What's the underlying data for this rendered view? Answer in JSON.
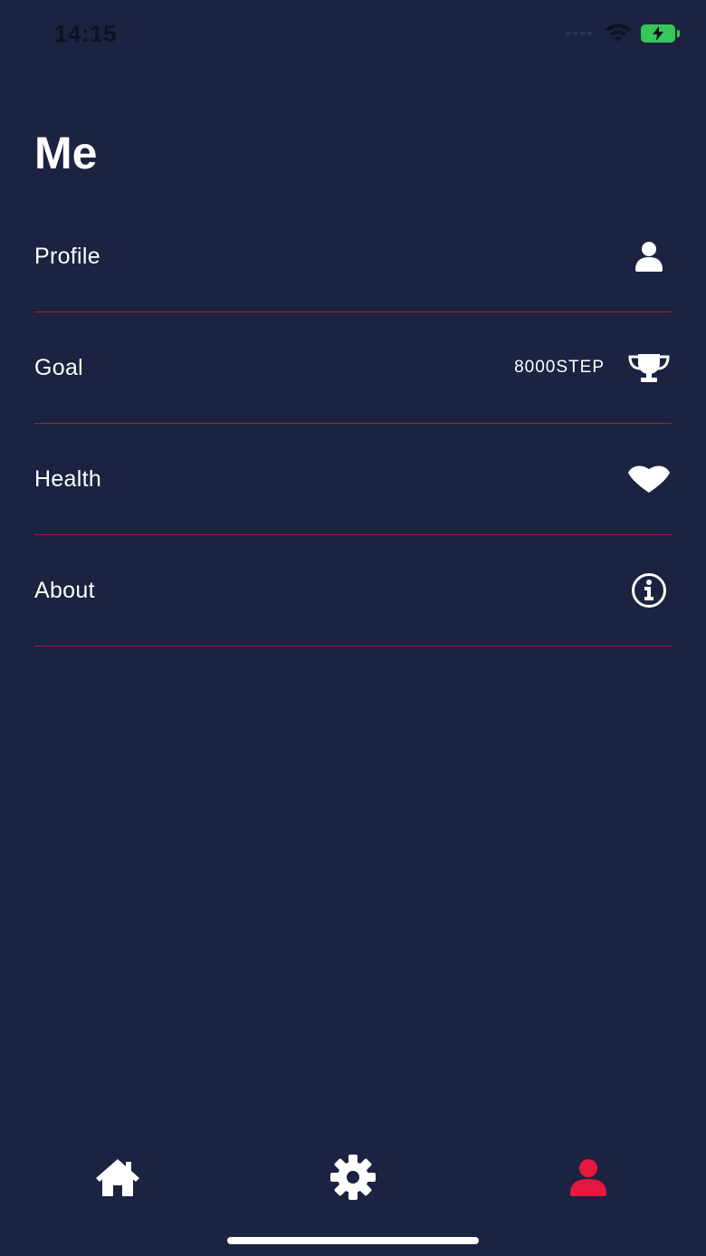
{
  "status_bar": {
    "time": "14:15",
    "battery_color": "#35c759"
  },
  "header": {
    "title": "Me"
  },
  "menu": {
    "items": [
      {
        "label": "Profile",
        "icon": "user-icon"
      },
      {
        "label": "Goal",
        "value": "8000STEP",
        "icon": "trophy-icon"
      },
      {
        "label": "Health",
        "icon": "heart-icon"
      },
      {
        "label": "About",
        "icon": "info-icon"
      }
    ]
  },
  "tab_bar": {
    "tabs": [
      {
        "name": "home",
        "icon": "home-icon",
        "active": false
      },
      {
        "name": "settings",
        "icon": "gear-icon",
        "active": false
      },
      {
        "name": "me",
        "icon": "user-icon",
        "active": true
      }
    ],
    "active_color": "#e5173f",
    "inactive_color": "#ffffff"
  },
  "colors": {
    "background": "#1b2340",
    "divider": "#a31f3a",
    "accent": "#e5173f"
  }
}
